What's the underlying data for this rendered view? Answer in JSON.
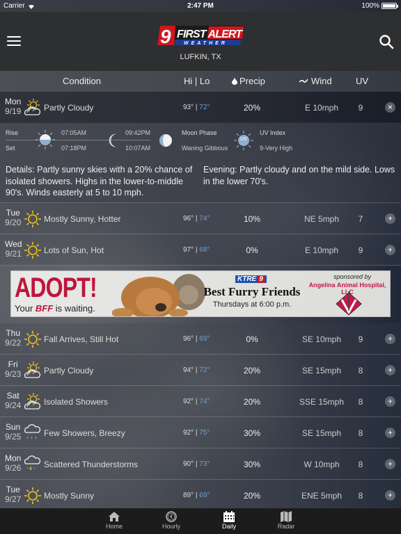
{
  "status_bar": {
    "carrier": "Carrier",
    "time": "2:47 PM",
    "battery": "100%"
  },
  "header": {
    "logo_number": "9",
    "logo_title": "FIRST ALERT",
    "logo_subtitle": "WEATHER",
    "location": "LUFKIN, TX"
  },
  "columns": {
    "condition": "Condition",
    "hilo": "Hi | Lo",
    "precip": "Precip",
    "wind": "Wind",
    "uv": "UV"
  },
  "colors": {
    "lo_temp": "#6fa0d0",
    "sun_icon": "#f2c518",
    "header_bg": "#2e2f31",
    "tabbar_bg": "#1c1c1c"
  },
  "days": [
    {
      "day": "Mon",
      "date": "9/19",
      "icon": "partly-cloudy-icon",
      "condition": "Partly Cloudy",
      "hi": "93°",
      "lo": "72°",
      "precip": "20%",
      "wind": "E 10mph",
      "uv": "9",
      "toggle": "×",
      "expanded": true
    },
    {
      "day": "Tue",
      "date": "9/20",
      "icon": "sunny-icon",
      "condition": "Mostly Sunny, Hotter",
      "hi": "96°",
      "lo": "74°",
      "precip": "10%",
      "wind": "NE 5mph",
      "uv": "7",
      "toggle": "+"
    },
    {
      "day": "Wed",
      "date": "9/21",
      "icon": "sunny-icon",
      "condition": "Lots of Sun, Hot",
      "hi": "97°",
      "lo": "68°",
      "precip": "0%",
      "wind": "E 10mph",
      "uv": "9",
      "toggle": "+"
    },
    {
      "day": "Thu",
      "date": "9/22",
      "icon": "sunny-icon",
      "condition": "Fall Arrives, Still Hot",
      "hi": "96°",
      "lo": "69°",
      "precip": "0%",
      "wind": "SE 10mph",
      "uv": "9",
      "toggle": "+"
    },
    {
      "day": "Fri",
      "date": "9/23",
      "icon": "partly-cloudy-icon",
      "condition": "Partly Cloudy",
      "hi": "94°",
      "lo": "72°",
      "precip": "20%",
      "wind": "SE 15mph",
      "uv": "8",
      "toggle": "+"
    },
    {
      "day": "Sat",
      "date": "9/24",
      "icon": "partly-cloudy-icon",
      "condition": "Isolated Showers",
      "hi": "92°",
      "lo": "74°",
      "precip": "20%",
      "wind": "SSE 15mph",
      "uv": "8",
      "toggle": "+"
    },
    {
      "day": "Sun",
      "date": "9/25",
      "icon": "showers-icon",
      "condition": "Few Showers, Breezy",
      "hi": "92°",
      "lo": "75°",
      "precip": "30%",
      "wind": "SE 15mph",
      "uv": "8",
      "toggle": "+"
    },
    {
      "day": "Mon",
      "date": "9/26",
      "icon": "thunderstorm-icon",
      "condition": "Scattered Thunderstorms",
      "hi": "90°",
      "lo": "73°",
      "precip": "30%",
      "wind": "W 10mph",
      "uv": "8",
      "toggle": "+"
    },
    {
      "day": "Tue",
      "date": "9/27",
      "icon": "sunny-icon",
      "condition": "Mostly Sunny",
      "hi": "89°",
      "lo": "69°",
      "precip": "20%",
      "wind": "ENE 5mph",
      "uv": "8",
      "toggle": "+"
    }
  ],
  "details": {
    "rise_label": "Rise",
    "set_label": "Set",
    "sunrise": "07:05AM",
    "sunset": "07:18PM",
    "moonrise": "09:42PM",
    "moonset": "10:07AM",
    "moon_phase_label": "Moon Phase",
    "moon_phase": "Waning Gibbous",
    "uv_label": "UV Index",
    "uv_value": "9-Very High",
    "uv_badge": "UV",
    "day_text": "Details: Partly sunny skies with a 20% chance of isolated showers.  Highs in the lower-to-middle 90's.  Winds easterly at 5 to 10 mph.",
    "evening_text": "Evening: Partly cloudy and on the mild side. Lows in the lower 70's."
  },
  "ad": {
    "headline": "ADOPT!",
    "tagline_pre": "Your ",
    "tagline_bff": "BFF",
    "tagline_post": " is waiting.",
    "station": "KTRE",
    "station_num": "9",
    "show": "Best Furry Friends",
    "schedule": "Thursdays at 6:00 p.m.",
    "sponsored_by": "sponsored by",
    "sponsor": "Angelina Animal Hospital, LLC"
  },
  "tabs": [
    {
      "label": "Home",
      "icon": "home-icon",
      "active": false
    },
    {
      "label": "Hourly",
      "icon": "clock-icon",
      "active": false
    },
    {
      "label": "Daily",
      "icon": "calendar-icon",
      "active": true
    },
    {
      "label": "Radar",
      "icon": "map-icon",
      "active": false
    }
  ]
}
